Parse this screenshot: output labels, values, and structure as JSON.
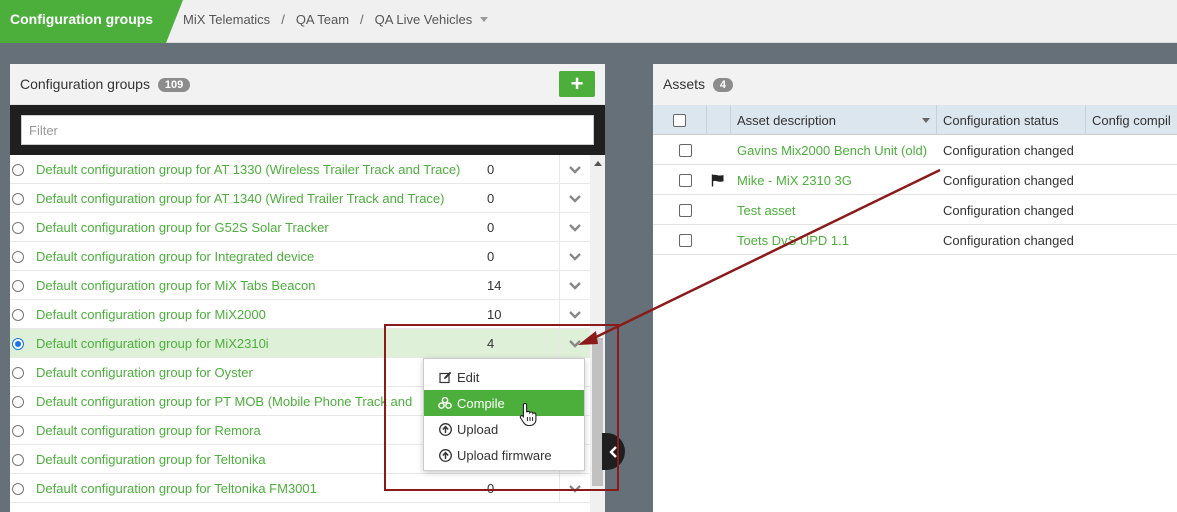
{
  "brand": {
    "title": "Configuration groups",
    "color": "#4caf3c"
  },
  "breadcrumb": [
    "MiX Telematics",
    "QA Team",
    "QA Live Vehicles"
  ],
  "groups_panel": {
    "title": "Configuration groups",
    "count": "109",
    "add_label": "+",
    "filter_placeholder": "Filter",
    "rows": [
      {
        "name": "Default configuration group for AT 1330 (Wireless Trailer Track and Trace)",
        "count": "0",
        "selected": false
      },
      {
        "name": "Default configuration group for AT 1340 (Wired Trailer Track and Trace)",
        "count": "0",
        "selected": false
      },
      {
        "name": "Default configuration group for G52S Solar Tracker",
        "count": "0",
        "selected": false
      },
      {
        "name": "Default configuration group for Integrated device",
        "count": "0",
        "selected": false
      },
      {
        "name": "Default configuration group for MiX Tabs Beacon",
        "count": "14",
        "selected": false
      },
      {
        "name": "Default configuration group for MiX2000",
        "count": "10",
        "selected": false
      },
      {
        "name": "Default configuration group for MiX2310i",
        "count": "4",
        "selected": true
      },
      {
        "name": "Default configuration group for Oyster",
        "count": "",
        "selected": false
      },
      {
        "name": "Default configuration group for PT MOB (Mobile Phone Track and",
        "count": "",
        "selected": false
      },
      {
        "name": "Default configuration group for Remora",
        "count": "",
        "selected": false
      },
      {
        "name": "Default configuration group for Teltonika",
        "count": "",
        "selected": false
      },
      {
        "name": "Default configuration group for Teltonika FM3001",
        "count": "0",
        "selected": false
      }
    ]
  },
  "context_menu": {
    "items": [
      {
        "label": "Edit",
        "icon": "edit-icon",
        "active": false
      },
      {
        "label": "Compile",
        "icon": "compile-icon",
        "active": true
      },
      {
        "label": "Upload",
        "icon": "upload-icon",
        "active": false
      },
      {
        "label": "Upload firmware",
        "icon": "upload-firmware-icon",
        "active": false
      }
    ]
  },
  "assets_panel": {
    "title": "Assets",
    "count": "4",
    "columns": [
      "Asset description",
      "Configuration status",
      "Config compil"
    ],
    "rows": [
      {
        "description": "Gavins Mix2000 Bench Unit (old)",
        "status": "Configuration changed",
        "flag": false
      },
      {
        "description": "Mike - MiX 2310 3G",
        "status": "Configuration changed",
        "flag": true
      },
      {
        "description": "Test asset",
        "status": "Configuration changed",
        "flag": false
      },
      {
        "description": "Toets DvS UPD 1.1",
        "status": "Configuration changed",
        "flag": false
      }
    ]
  },
  "colors": {
    "accent": "#4caf3c",
    "annotation": "#8b1a1a",
    "header_bg": "#dce6ee"
  }
}
